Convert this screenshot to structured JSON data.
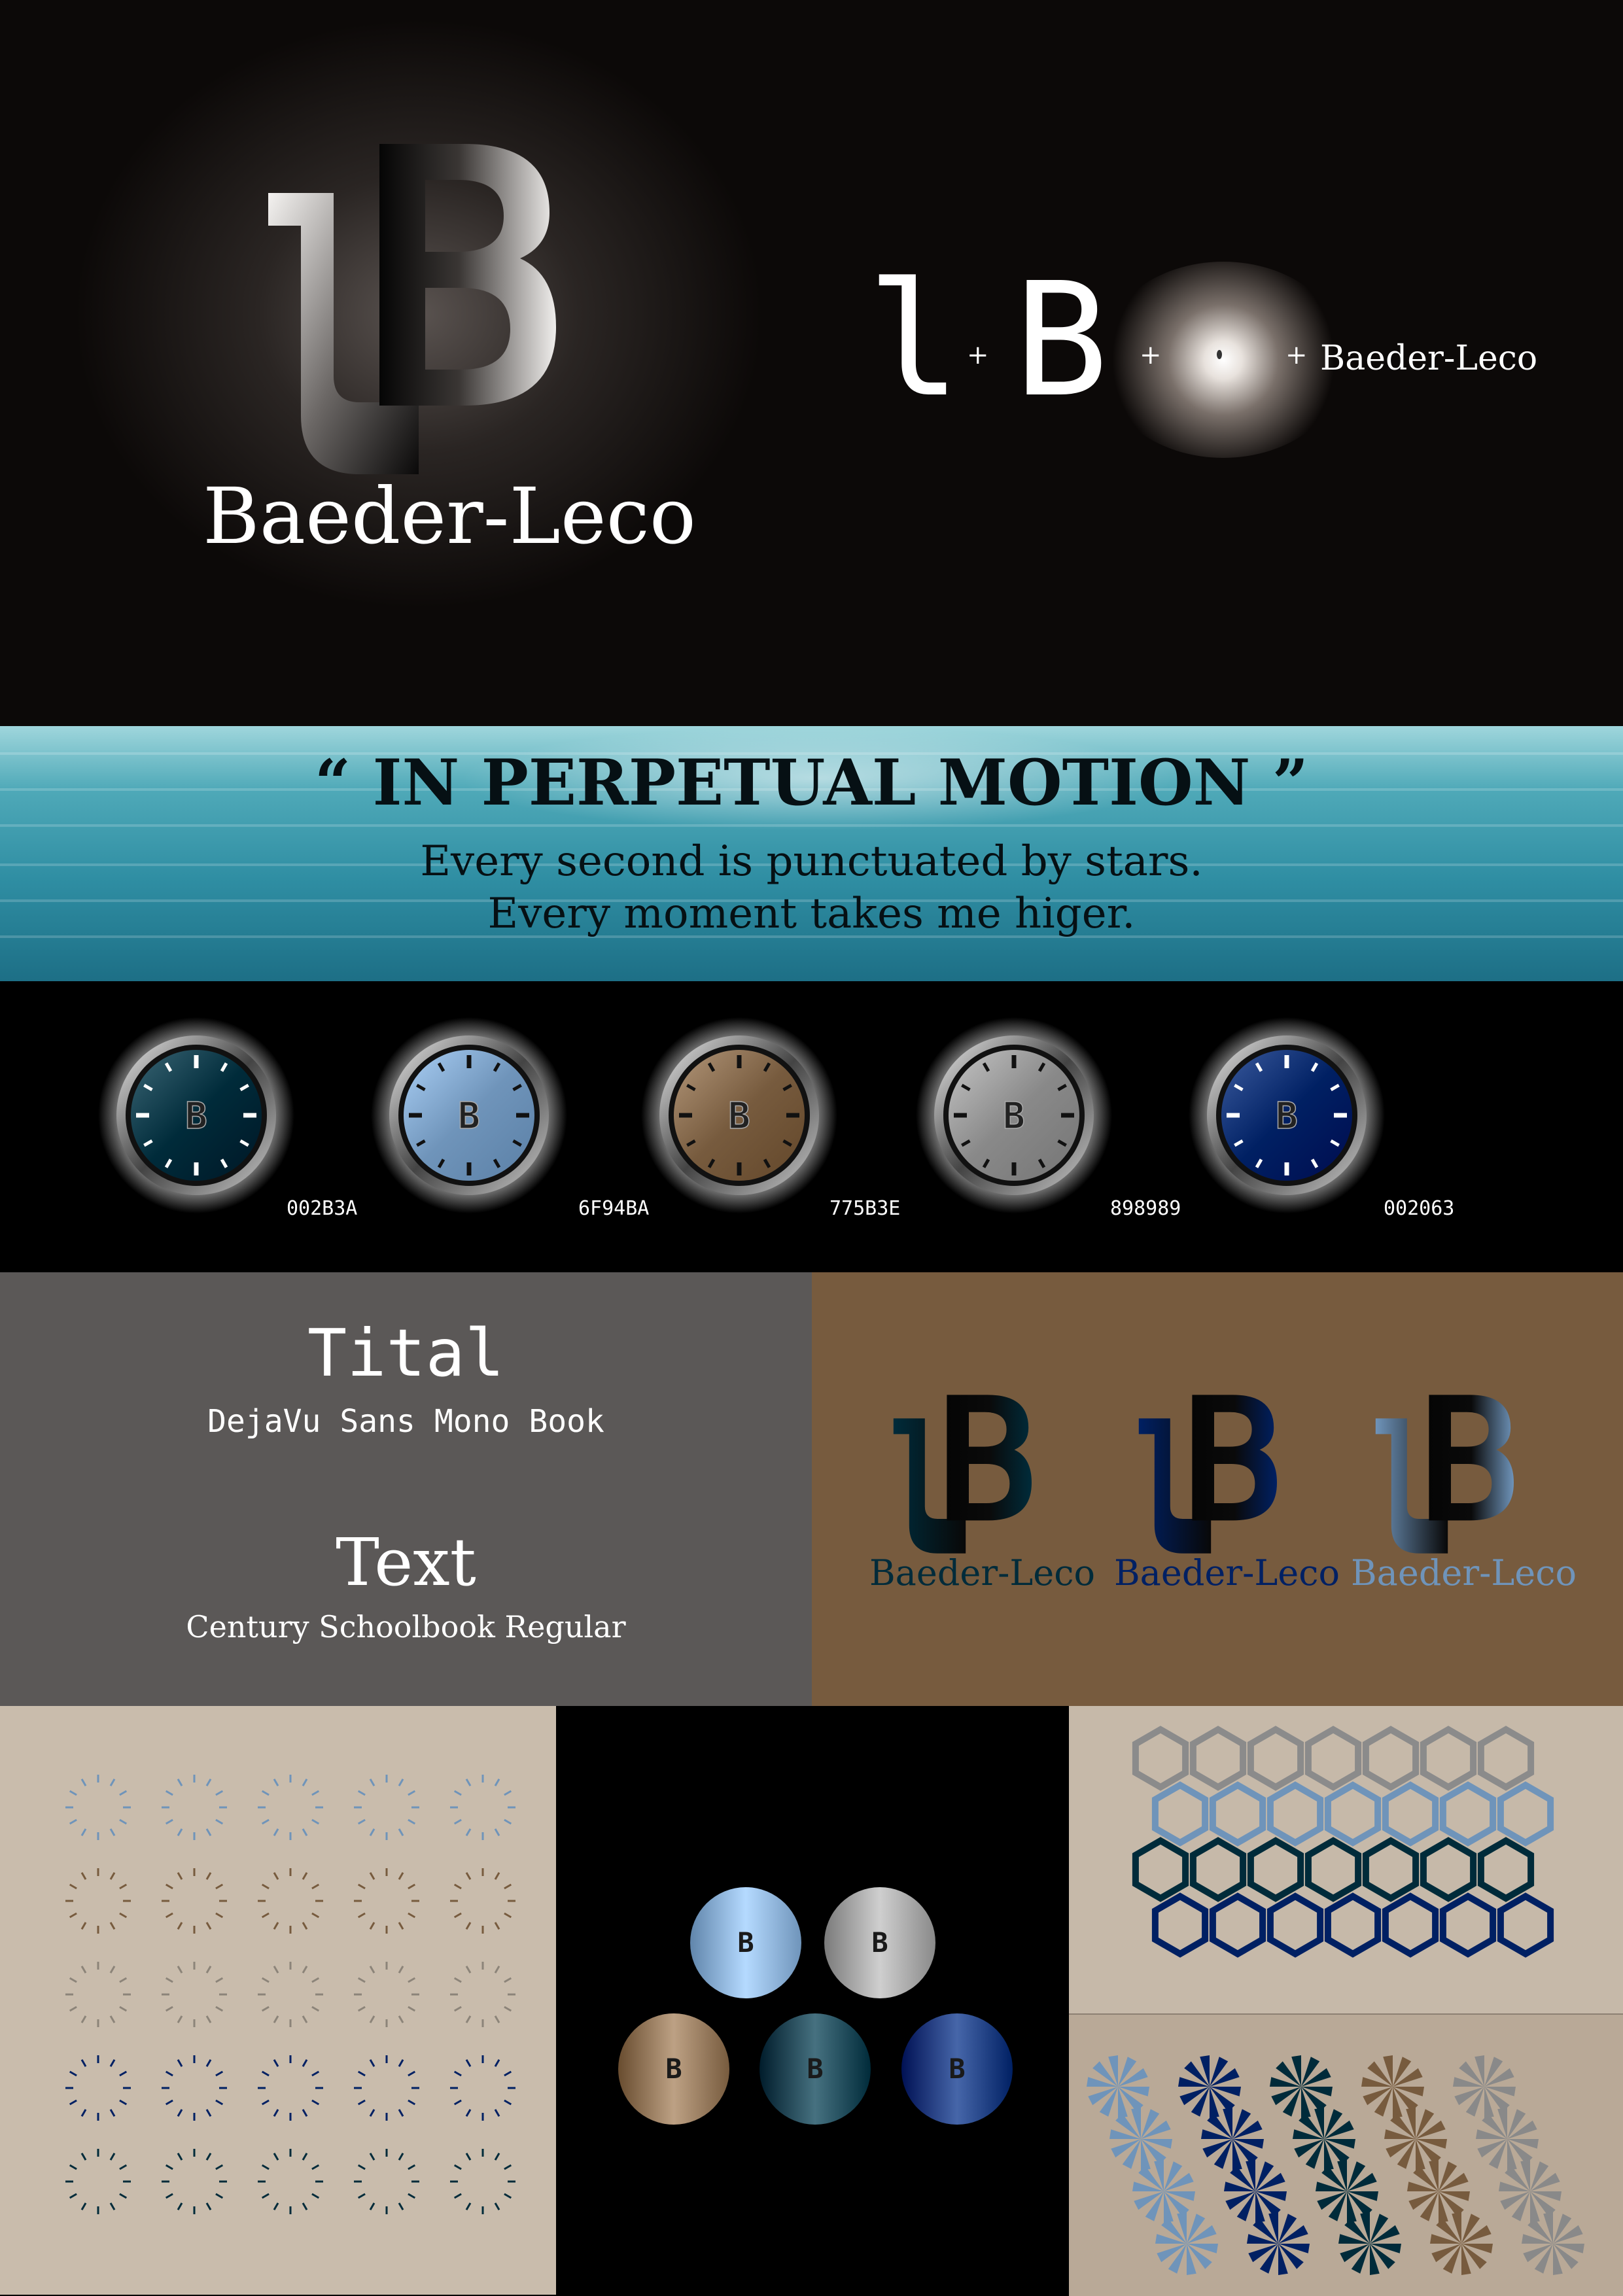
{
  "brand": {
    "name": "Baeder-Leco",
    "monogram_l": "l",
    "monogram_b": "B",
    "plus": "+"
  },
  "tagline": {
    "headline": "“ IN PERPETUAL MOTION ”",
    "line1": "Every second is punctuated by stars.",
    "line2": "Every moment takes me higer."
  },
  "watches": [
    {
      "code": "002B3A",
      "color": "#002B3A"
    },
    {
      "code": "6F94BA",
      "color": "#6F94BA"
    },
    {
      "code": "775B3E",
      "color": "#775B3E"
    },
    {
      "code": "898989",
      "color": "#898989"
    },
    {
      "code": "002063",
      "color": "#002063"
    }
  ],
  "typography": {
    "title_sample": "Tital",
    "title_font": "DejaVu Sans Mono Book",
    "text_sample": "Text",
    "text_font": "Century Schoolbook Regular"
  },
  "logo_variants": [
    {
      "color": "#002B3A"
    },
    {
      "color": "#002063"
    },
    {
      "color": "#6F94BA"
    }
  ],
  "palette": {
    "hero_bg": "#0c0908",
    "panel_grey": "#5b5857",
    "panel_brown": "#775B3E",
    "panel_beige": "#c9bcac"
  }
}
